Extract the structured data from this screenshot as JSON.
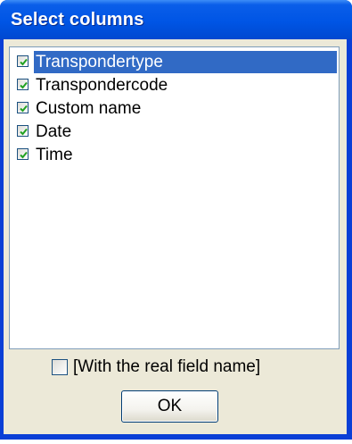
{
  "window": {
    "title": "Select columns",
    "accent_color": "#0055e5",
    "selection_color": "#316ac5"
  },
  "columns": [
    {
      "label": "Transpondertype",
      "checked": true,
      "selected": true
    },
    {
      "label": "Transpondercode",
      "checked": true,
      "selected": false
    },
    {
      "label": "Custom name",
      "checked": true,
      "selected": false
    },
    {
      "label": "Date",
      "checked": true,
      "selected": false
    },
    {
      "label": "Time",
      "checked": true,
      "selected": false
    }
  ],
  "real_field_name": {
    "label": "[With the real field name]",
    "checked": false
  },
  "buttons": {
    "ok_label": "OK"
  }
}
